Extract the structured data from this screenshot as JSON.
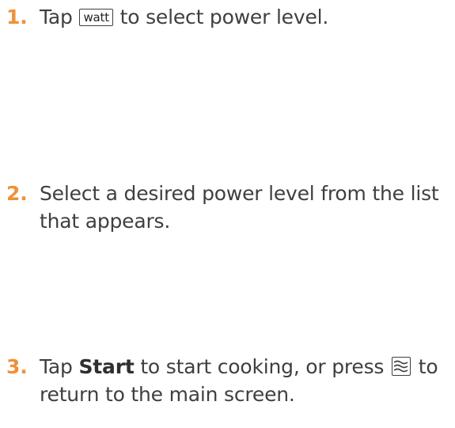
{
  "steps": [
    {
      "number": "1.",
      "before": "Tap ",
      "key_label": "watt",
      "after": " to select power level."
    },
    {
      "number": "2.",
      "line1": "Select a desired power level from the list",
      "line2": "that appears."
    },
    {
      "number": "3.",
      "before": "Tap ",
      "bold": "Start",
      "middle": " to start cooking, or press ",
      "icon": "home-waves-icon",
      "after": " to",
      "line2": "return to the main screen."
    }
  ],
  "colors": {
    "number": "#f0903a",
    "text": "#3f3f3f"
  }
}
